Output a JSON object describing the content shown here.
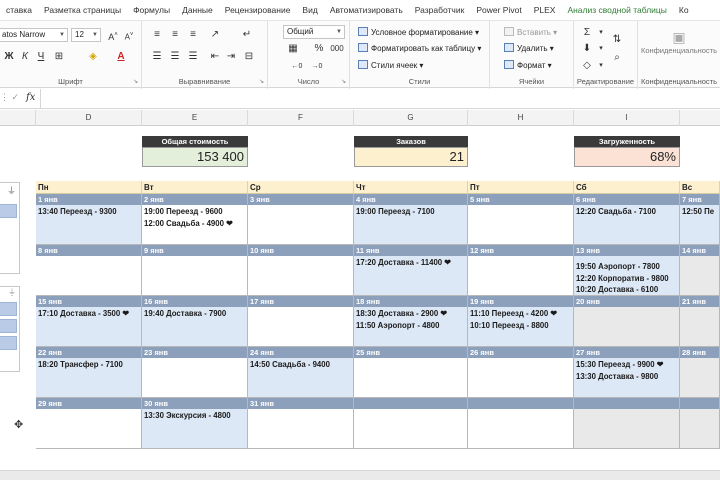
{
  "ribbon_tabs": [
    {
      "label": "ставка",
      "accent": false
    },
    {
      "label": "Разметка страницы",
      "accent": false
    },
    {
      "label": "Формулы",
      "accent": false
    },
    {
      "label": "Данные",
      "accent": false
    },
    {
      "label": "Рецензирование",
      "accent": false
    },
    {
      "label": "Вид",
      "accent": false
    },
    {
      "label": "Автоматизировать",
      "accent": false
    },
    {
      "label": "Разработчик",
      "accent": false
    },
    {
      "label": "Power Pivot",
      "accent": false
    },
    {
      "label": "PLEX",
      "accent": false
    },
    {
      "label": "Анализ сводной таблицы",
      "accent": true
    },
    {
      "label": "Ко",
      "accent": false
    }
  ],
  "font_group": {
    "font_name": "atos Narrow",
    "font_size": "12",
    "label": "Шрифт"
  },
  "alignment_group": {
    "label": "Выравнивание"
  },
  "number_group": {
    "format": "Общий",
    "label": "Число"
  },
  "styles_group": {
    "conditional": "Условное форматирование",
    "as_table": "Форматировать как таблицу",
    "cell_styles": "Стили ячеек",
    "label": "Стили"
  },
  "cells_group": {
    "insert": "Вставить",
    "delete": "Удалить",
    "format": "Формат",
    "label": "Ячейки"
  },
  "editing_group": {
    "label": "Редактирование"
  },
  "privacy_group": {
    "button": "Конфиденциальность",
    "label": "Конфиденциальность"
  },
  "formula_bar": {
    "fx": "fx",
    "content": ""
  },
  "columns": [
    "D",
    "E",
    "F",
    "G",
    "H",
    "I"
  ],
  "kpis": [
    {
      "title": "Общая стоимость",
      "value": "153 400",
      "color": "#e3efda"
    },
    {
      "title": "Заказов",
      "value": "21",
      "color": "#fdf0cf"
    },
    {
      "title": "Загруженность",
      "value": "68%",
      "color": "#fbe2d5"
    }
  ],
  "calendar": {
    "weekdays": [
      "Пн",
      "Вт",
      "Ср",
      "Чт",
      "Пт",
      "Сб",
      "Вс"
    ],
    "weeks": [
      [
        {
          "date": "1 янв",
          "style": "hl",
          "events": [
            "13:40 Переезд - 9300"
          ]
        },
        {
          "date": "2 янв",
          "style": "",
          "events": [
            "19:00 Переезд - 9600",
            "12:00 Свадьба - 4900 ❤"
          ]
        },
        {
          "date": "3 янв",
          "style": "",
          "events": []
        },
        {
          "date": "4 янв",
          "style": "hl",
          "events": [
            "19:00 Переезд - 7100"
          ]
        },
        {
          "date": "5 янв",
          "style": "",
          "events": []
        },
        {
          "date": "6 янв",
          "style": "hl",
          "events": [
            "12:20 Свадьба - 7100"
          ]
        },
        {
          "date": "7 янв",
          "style": "hl",
          "events": [
            "12:50 Пе"
          ]
        }
      ],
      [
        {
          "date": "8 янв",
          "style": "",
          "events": []
        },
        {
          "date": "9 янв",
          "style": "",
          "events": []
        },
        {
          "date": "10 янв",
          "style": "",
          "events": []
        },
        {
          "date": "11 янв",
          "style": "hl",
          "events": [
            "17:20 Доставка - 11400 ❤"
          ]
        },
        {
          "date": "12 янв",
          "style": "",
          "events": []
        },
        {
          "date": "13 янв",
          "style": "hl",
          "events": [
            "19:50 Аэропорт - 7800",
            "12:20 Корпоратив - 9800",
            "10:20 Доставка - 6100"
          ]
        },
        {
          "date": "14 янв",
          "style": "we",
          "events": []
        }
      ],
      [
        {
          "date": "15 янв",
          "style": "hl",
          "events": [
            "17:10 Доставка - 3500 ❤"
          ]
        },
        {
          "date": "16 янв",
          "style": "hl",
          "events": [
            "19:40 Доставка - 7900"
          ]
        },
        {
          "date": "17 янв",
          "style": "",
          "events": []
        },
        {
          "date": "18 янв",
          "style": "hl",
          "events": [
            "18:30 Доставка - 2900 ❤",
            "11:50 Аэропорт - 4800"
          ]
        },
        {
          "date": "19 янв",
          "style": "hl",
          "events": [
            "11:10 Переезд - 4200 ❤",
            "10:10 Переезд - 8800"
          ]
        },
        {
          "date": "20 янв",
          "style": "we",
          "events": []
        },
        {
          "date": "21 янв",
          "style": "we",
          "events": []
        }
      ],
      [
        {
          "date": "22 янв",
          "style": "hl",
          "events": [
            "18:20 Трансфер - 7100"
          ]
        },
        {
          "date": "23 янв",
          "style": "",
          "events": []
        },
        {
          "date": "24 янв",
          "style": "hl",
          "events": [
            "14:50 Свадьба - 9400"
          ]
        },
        {
          "date": "25 янв",
          "style": "",
          "events": []
        },
        {
          "date": "26 янв",
          "style": "",
          "events": []
        },
        {
          "date": "27 янв",
          "style": "hl",
          "events": [
            "15:30 Переезд - 9900 ❤",
            "13:30 Доставка - 9800"
          ]
        },
        {
          "date": "28 янв",
          "style": "we",
          "events": []
        }
      ],
      [
        {
          "date": "29 янв",
          "style": "",
          "events": []
        },
        {
          "date": "30 янв",
          "style": "hl",
          "events": [
            "13:30 Экскурсия - 4800"
          ]
        },
        {
          "date": "31 янв",
          "style": "",
          "events": []
        },
        {
          "date": "",
          "style": "",
          "events": []
        },
        {
          "date": "",
          "style": "",
          "events": []
        },
        {
          "date": "",
          "style": "we",
          "events": []
        },
        {
          "date": "",
          "style": "we",
          "events": []
        }
      ]
    ]
  }
}
